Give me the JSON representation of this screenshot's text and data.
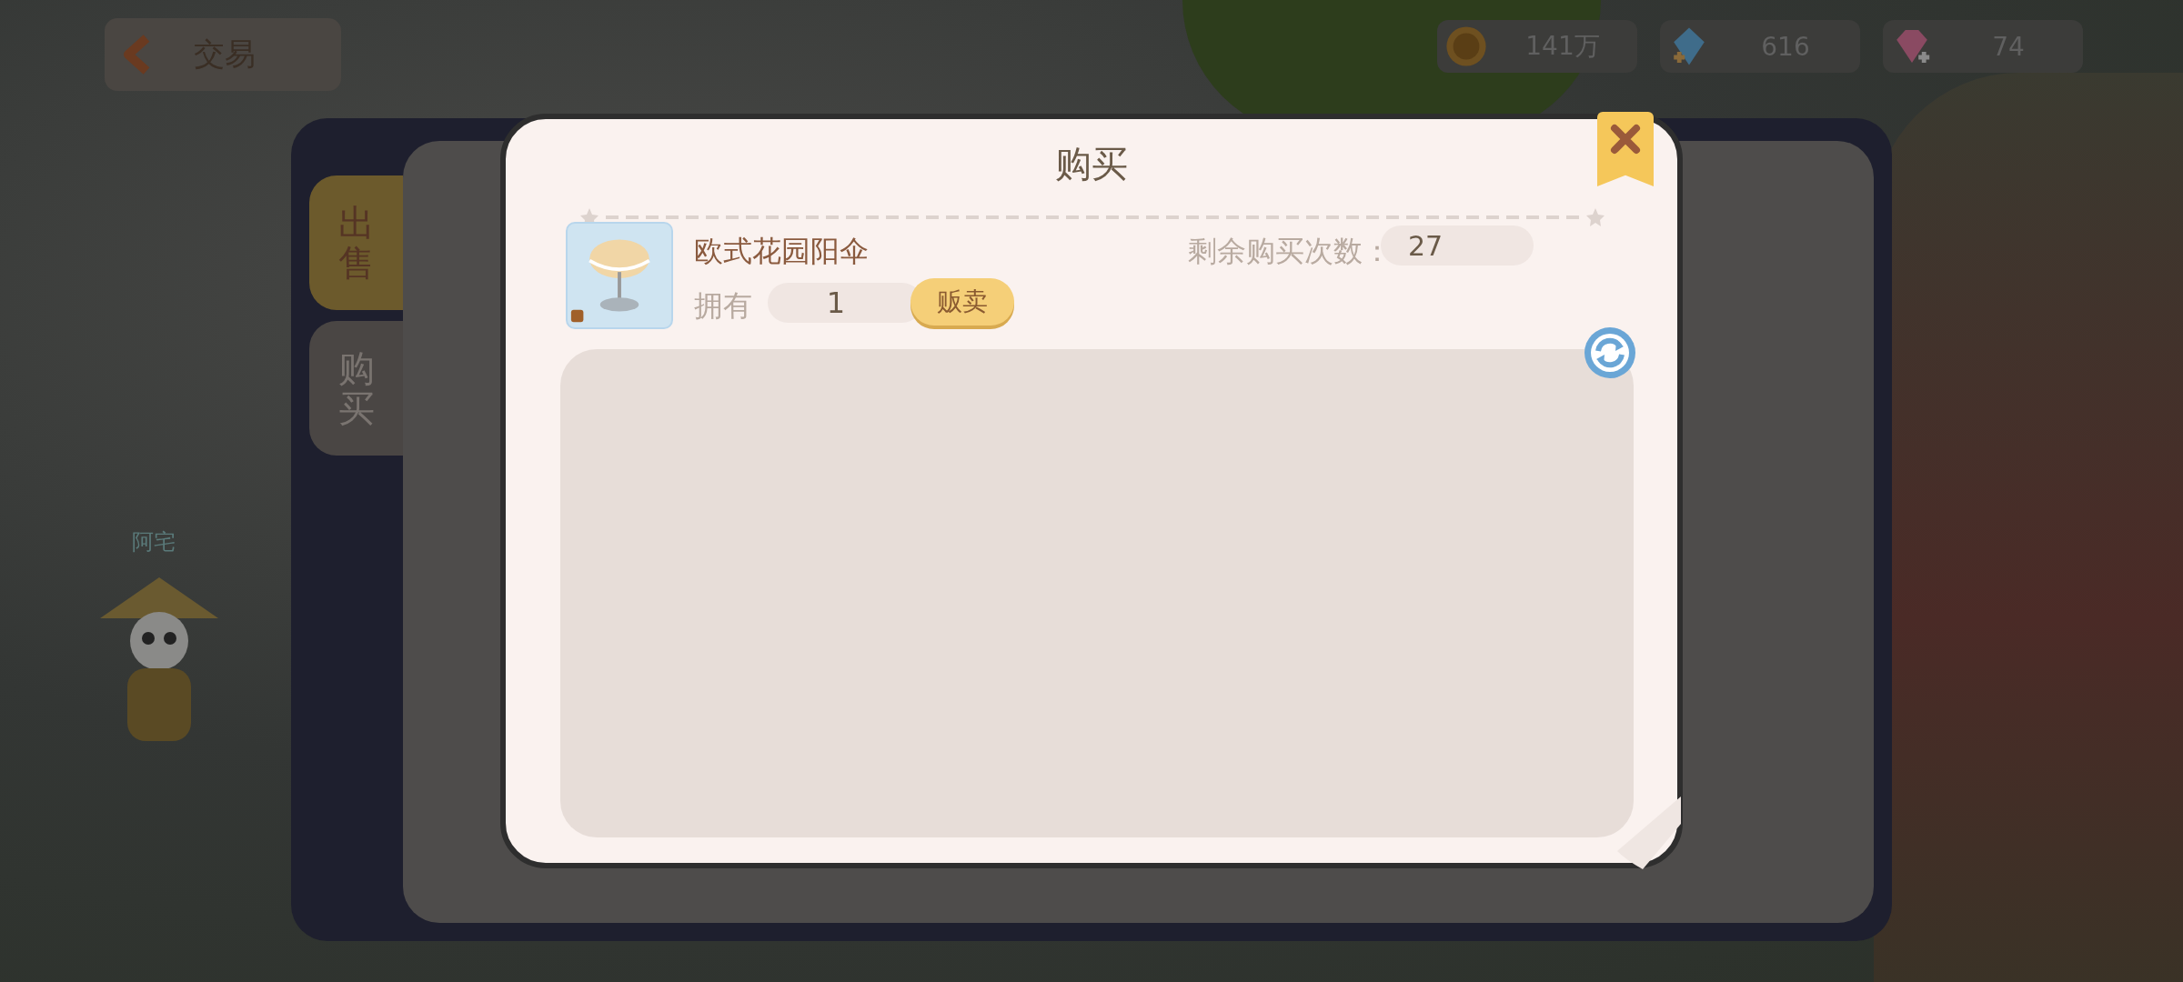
{
  "top_bar": {
    "title": "交易",
    "resources": [
      {
        "kind": "coin",
        "amount": "141万"
      },
      {
        "kind": "crystal",
        "amount": "616"
      },
      {
        "kind": "gem",
        "amount": "74"
      }
    ]
  },
  "scene": {
    "npc_name": "阿宅"
  },
  "trade_panel": {
    "tabs": [
      {
        "label": "出售",
        "selected": true
      },
      {
        "label": "购买",
        "selected": false
      }
    ]
  },
  "dialog": {
    "title": "购买",
    "item": {
      "name": "欧式花园阳伞",
      "owned_label": "拥有",
      "owned": "1",
      "sell_button": "贩卖",
      "remaining_label": "剩余购买次数：",
      "remaining": "27"
    }
  }
}
